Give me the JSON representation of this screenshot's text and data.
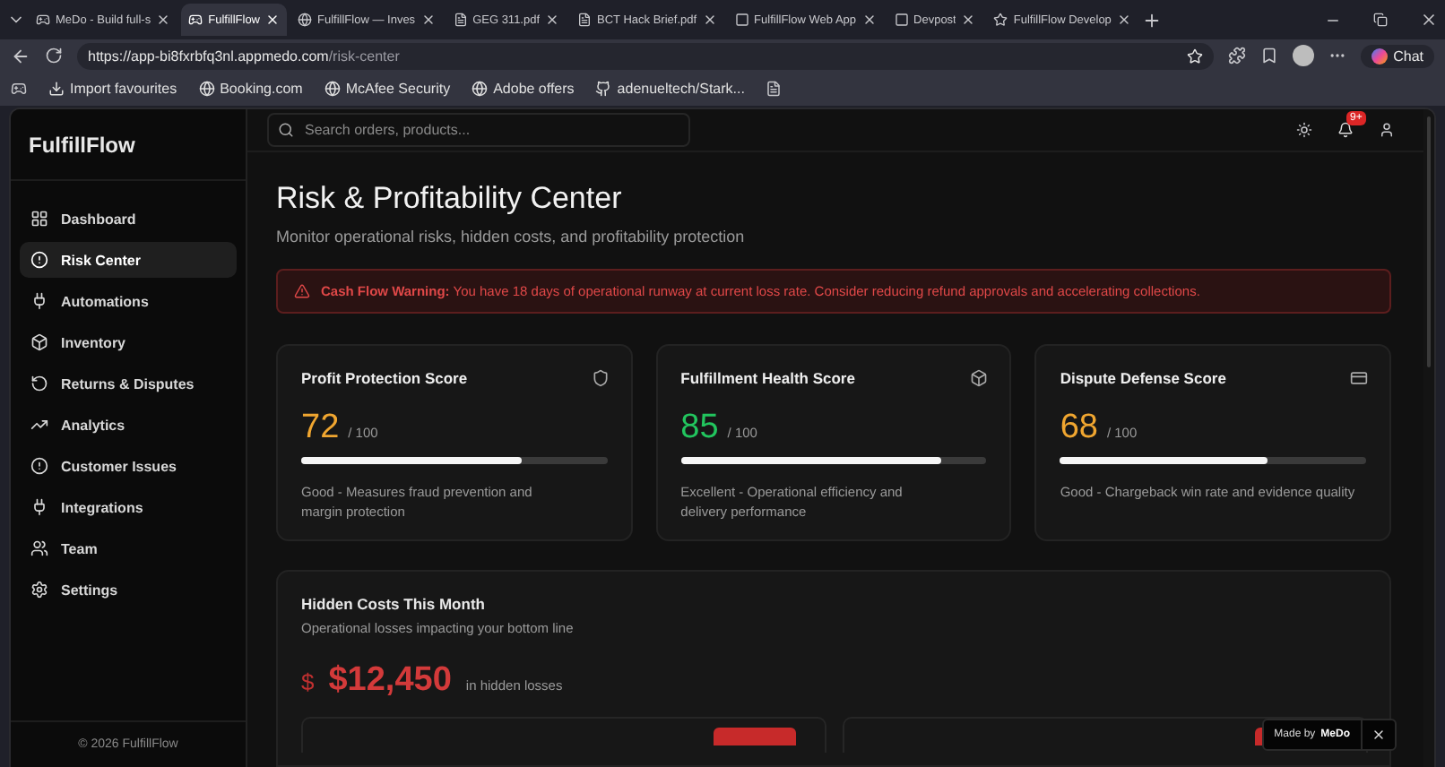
{
  "browser": {
    "tabs": [
      {
        "label": "MeDo - Build full-s",
        "selected": false
      },
      {
        "label": "FulfillFlow",
        "selected": true
      },
      {
        "label": "FulfillFlow — Inves",
        "selected": false
      },
      {
        "label": "GEG 311.pdf",
        "selected": false
      },
      {
        "label": "BCT Hack Brief.pdf",
        "selected": false
      },
      {
        "label": "FulfillFlow Web App",
        "selected": false
      },
      {
        "label": "Devpost",
        "selected": false
      },
      {
        "label": "FulfillFlow Develop",
        "selected": false
      }
    ],
    "address": {
      "host": "https://app-bi8fxrbfq3nl.appmedo.com",
      "path": "/risk-center"
    },
    "chat_button": "Chat",
    "bookmarks": [
      "Import favourites",
      "Booking.com",
      "McAfee Security",
      "Adobe offers",
      "adenueltech/Stark..."
    ]
  },
  "sidebar": {
    "brand": "FulfillFlow",
    "items": [
      {
        "label": "Dashboard",
        "selected": false
      },
      {
        "label": "Risk Center",
        "selected": true
      },
      {
        "label": "Automations",
        "selected": false
      },
      {
        "label": "Inventory",
        "selected": false
      },
      {
        "label": "Returns & Disputes",
        "selected": false
      },
      {
        "label": "Analytics",
        "selected": false
      },
      {
        "label": "Customer Issues",
        "selected": false
      },
      {
        "label": "Integrations",
        "selected": false
      },
      {
        "label": "Team",
        "selected": false
      },
      {
        "label": "Settings",
        "selected": false
      }
    ],
    "footer": "© 2026 FulfillFlow"
  },
  "header": {
    "search": {
      "placeholder": "Search orders, products..."
    },
    "notification_badge": "9+"
  },
  "page": {
    "title": "Risk & Profitability Center",
    "subtitle": "Monitor operational risks, hidden costs, and profitability protection",
    "alert": {
      "label": "Cash Flow Warning:",
      "message": "You have 18 days of operational runway at current loss rate. Consider reducing refund approvals and accelerating collections."
    },
    "scores": [
      {
        "title": "Profit Protection Score",
        "value": "72",
        "max": "/ 100",
        "level": 0.72,
        "color": "#f0a630",
        "description": "Good - Measures fraud prevention and margin protection"
      },
      {
        "title": "Fulfillment Health Score",
        "value": "85",
        "max": "/ 100",
        "level": 0.85,
        "color": "#22c55e",
        "description": "Excellent - Operational efficiency and delivery performance"
      },
      {
        "title": "Dispute Defense Score",
        "value": "68",
        "max": "/ 100",
        "level": 0.68,
        "color": "#f0a630",
        "description": "Good - Chargeback win rate and evidence quality"
      }
    ],
    "hidden_costs": {
      "title": "Hidden Costs This Month",
      "subtitle": "Operational losses impacting your bottom line",
      "currency": "$",
      "amount": "$12,450",
      "caption": "in hidden losses"
    }
  },
  "made_by": {
    "label": "Made by",
    "brand": "MeDo"
  }
}
